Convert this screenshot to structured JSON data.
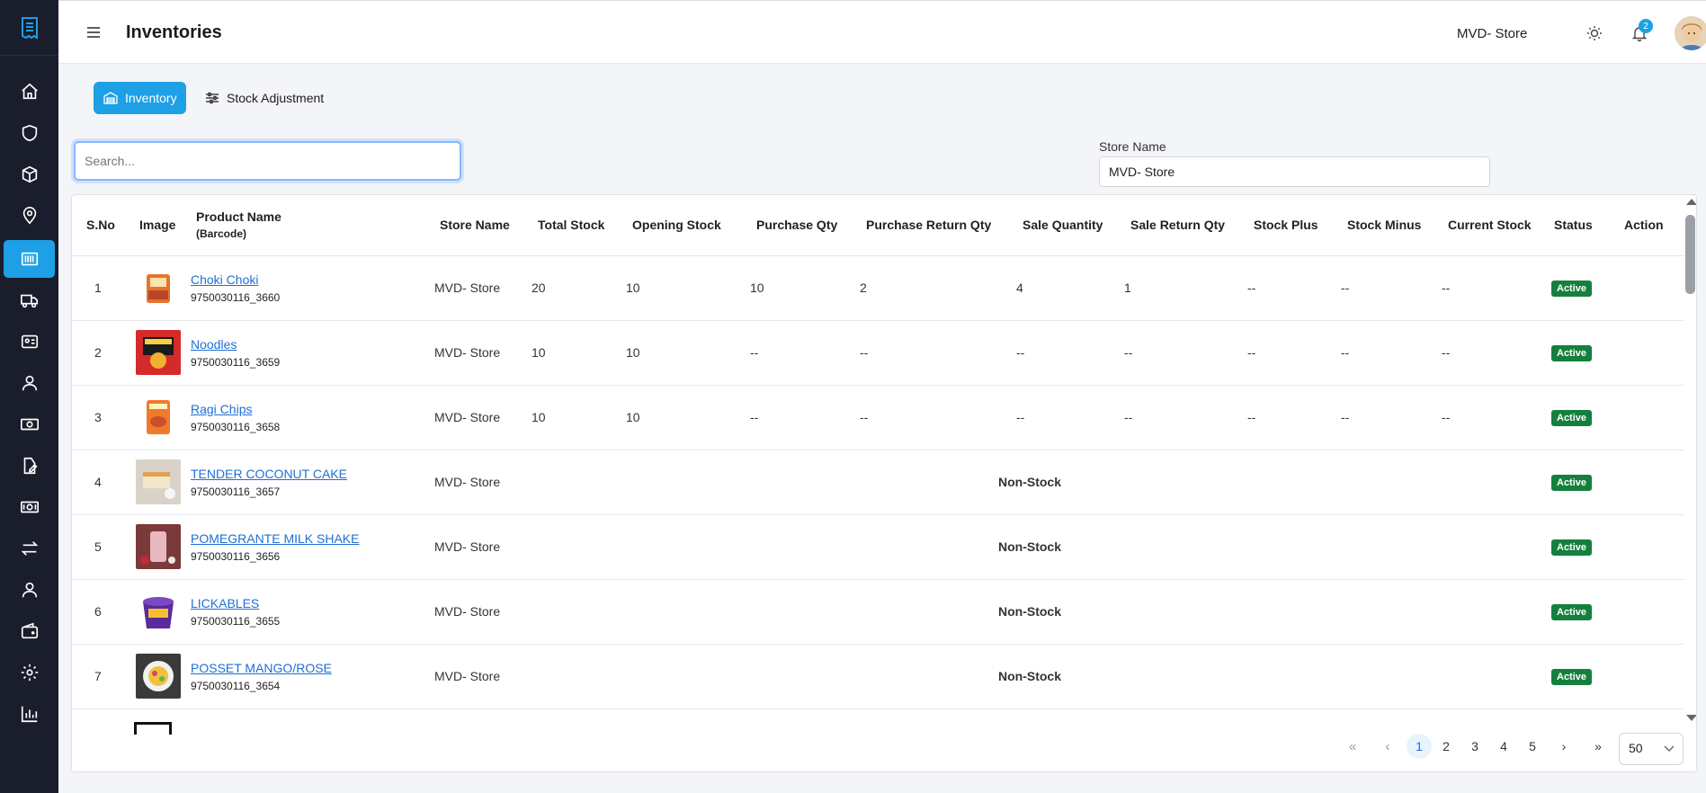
{
  "header": {
    "title": "Inventories",
    "store": "MVD- Store",
    "notification_count": "2"
  },
  "tabs": [
    {
      "label": "Inventory",
      "active": true
    },
    {
      "label": "Stock Adjustment",
      "active": false
    }
  ],
  "search": {
    "placeholder": "Search...",
    "value": ""
  },
  "store_filter": {
    "label": "Store Name",
    "value": "MVD- Store"
  },
  "sidebar": {
    "items": [
      {
        "icon": "home-icon"
      },
      {
        "icon": "shield-icon"
      },
      {
        "icon": "cube-icon"
      },
      {
        "icon": "location-pin-icon"
      },
      {
        "icon": "barcode-icon",
        "active": true
      },
      {
        "icon": "truck-icon"
      },
      {
        "icon": "id-card-icon"
      },
      {
        "icon": "user-icon"
      },
      {
        "icon": "cash-icon"
      },
      {
        "icon": "edit-document-icon"
      },
      {
        "icon": "money-icon"
      },
      {
        "icon": "transfer-arrows-icon"
      },
      {
        "icon": "user-profile-icon"
      },
      {
        "icon": "wallet-icon"
      },
      {
        "icon": "gear-icon"
      },
      {
        "icon": "bar-chart-icon"
      }
    ]
  },
  "table": {
    "columns": {
      "sno": "S.No",
      "image": "Image",
      "product": "Product Name",
      "product_sub": "(Barcode)",
      "store": "Store Name",
      "total": "Total Stock",
      "opening": "Opening Stock",
      "purchase": "Purchase Qty",
      "purchase_return": "Purchase Return Qty",
      "sale": "Sale Quantity",
      "sale_return": "Sale Return Qty",
      "plus": "Stock Plus",
      "minus": "Stock Minus",
      "current": "Current Stock",
      "status": "Status",
      "action": "Action"
    },
    "rows": [
      {
        "sno": "1",
        "name": "Choki Choki",
        "barcode": "9750030116_3660",
        "store": "MVD- Store",
        "total": "20",
        "opening": "10",
        "purchase": "10",
        "purchase_return": "2",
        "sale": "4",
        "sale_return": "1",
        "plus": "--",
        "minus": "--",
        "current": "--",
        "status": "Active"
      },
      {
        "sno": "2",
        "name": "Noodles",
        "barcode": "9750030116_3659",
        "store": "MVD- Store",
        "total": "10",
        "opening": "10",
        "purchase": "--",
        "purchase_return": "--",
        "sale": "--",
        "sale_return": "--",
        "plus": "--",
        "minus": "--",
        "current": "--",
        "status": "Active"
      },
      {
        "sno": "3",
        "name": "Ragi Chips",
        "barcode": "9750030116_3658",
        "store": "MVD- Store",
        "total": "10",
        "opening": "10",
        "purchase": "--",
        "purchase_return": "--",
        "sale": "--",
        "sale_return": "--",
        "plus": "--",
        "minus": "--",
        "current": "--",
        "status": "Active"
      },
      {
        "sno": "4",
        "name": "TENDER COCONUT CAKE",
        "barcode": "9750030116_3657",
        "store": "MVD- Store",
        "nonstock": "Non-Stock",
        "status": "Active"
      },
      {
        "sno": "5",
        "name": "POMEGRANTE MILK SHAKE",
        "barcode": "9750030116_3656",
        "store": "MVD- Store",
        "nonstock": "Non-Stock",
        "status": "Active"
      },
      {
        "sno": "6",
        "name": "LICKABLES",
        "barcode": "9750030116_3655",
        "store": "MVD- Store",
        "nonstock": "Non-Stock",
        "status": "Active"
      },
      {
        "sno": "7",
        "name": "POSSET MANGO/ROSE",
        "barcode": "9750030116_3654",
        "store": "MVD- Store",
        "nonstock": "Non-Stock",
        "status": "Active"
      }
    ]
  },
  "pagination": {
    "first": "«",
    "prev": "‹",
    "pages": [
      "1",
      "2",
      "3",
      "4",
      "5"
    ],
    "current": "1",
    "next": "›",
    "last": "»",
    "page_size": "50"
  },
  "colors": {
    "accent": "#1ea0e6",
    "sidebar_bg": "#1a1d2b",
    "active_badge": "#15803d",
    "link": "#1f6fd6"
  }
}
